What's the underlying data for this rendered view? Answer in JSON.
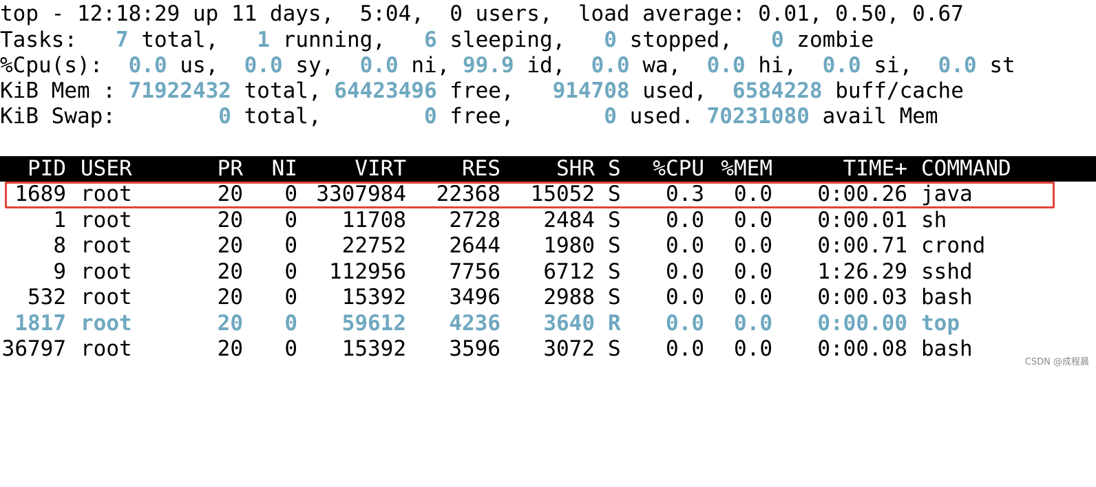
{
  "summary": {
    "line1": "top - 12:18:29 up 11 days,  5:04,  0 users,  load average: 0.01, 0.50, 0.67",
    "tasks": {
      "label": "Tasks:",
      "total": "7",
      "total_label": "total,",
      "running": "1",
      "running_label": "running,",
      "sleeping": "6",
      "sleeping_label": "sleeping,",
      "stopped": "0",
      "stopped_label": "stopped,",
      "zombie": "0",
      "zombie_label": "zombie"
    },
    "cpu": {
      "label": "%Cpu(s):",
      "us": "0.0",
      "us_label": "us,",
      "sy": "0.0",
      "sy_label": "sy,",
      "ni": "0.0",
      "ni_label": "ni,",
      "id": "99.9",
      "id_label": "id,",
      "wa": "0.0",
      "wa_label": "wa,",
      "hi": "0.0",
      "hi_label": "hi,",
      "si": "0.0",
      "si_label": "si,",
      "st": "0.0",
      "st_label": "st"
    },
    "mem": {
      "label": "KiB Mem :",
      "total": "71922432",
      "total_label": "total,",
      "free": "64423496",
      "free_label": "free,",
      "used": "914708",
      "used_label": "used,",
      "buff": "6584228",
      "buff_label": "buff/cache"
    },
    "swap": {
      "label": "KiB Swap:",
      "total": "0",
      "total_label": "total,",
      "free": "0",
      "free_label": "free,",
      "used": "0",
      "used_label": "used.",
      "avail": "70231080",
      "avail_label": "avail Mem"
    }
  },
  "columns": {
    "pid": "PID",
    "user": "USER",
    "pr": "PR",
    "ni": "NI",
    "virt": "VIRT",
    "res": "RES",
    "shr": "SHR",
    "s": "S",
    "cpu": "%CPU",
    "mem": "%MEM",
    "time": "TIME+",
    "command": "COMMAND"
  },
  "processes": [
    {
      "pid": "1689",
      "user": "root",
      "pr": "20",
      "ni": "0",
      "virt": "3307984",
      "res": "22368",
      "shr": "15052",
      "s": "S",
      "cpu": "0.3",
      "mem": "0.0",
      "time": "0:00.26",
      "command": "java"
    },
    {
      "pid": "1",
      "user": "root",
      "pr": "20",
      "ni": "0",
      "virt": "11708",
      "res": "2728",
      "shr": "2484",
      "s": "S",
      "cpu": "0.0",
      "mem": "0.0",
      "time": "0:00.01",
      "command": "sh"
    },
    {
      "pid": "8",
      "user": "root",
      "pr": "20",
      "ni": "0",
      "virt": "22752",
      "res": "2644",
      "shr": "1980",
      "s": "S",
      "cpu": "0.0",
      "mem": "0.0",
      "time": "0:00.71",
      "command": "crond"
    },
    {
      "pid": "9",
      "user": "root",
      "pr": "20",
      "ni": "0",
      "virt": "112956",
      "res": "7756",
      "shr": "6712",
      "s": "S",
      "cpu": "0.0",
      "mem": "0.0",
      "time": "1:26.29",
      "command": "sshd"
    },
    {
      "pid": "532",
      "user": "root",
      "pr": "20",
      "ni": "0",
      "virt": "15392",
      "res": "3496",
      "shr": "2988",
      "s": "S",
      "cpu": "0.0",
      "mem": "0.0",
      "time": "0:00.03",
      "command": "bash"
    },
    {
      "pid": "1817",
      "user": "root",
      "pr": "20",
      "ni": "0",
      "virt": "59612",
      "res": "4236",
      "shr": "3640",
      "s": "R",
      "cpu": "0.0",
      "mem": "0.0",
      "time": "0:00.00",
      "command": "top"
    },
    {
      "pid": "36797",
      "user": "root",
      "pr": "20",
      "ni": "0",
      "virt": "15392",
      "res": "3596",
      "shr": "3072",
      "s": "S",
      "cpu": "0.0",
      "mem": "0.0",
      "time": "0:00.08",
      "command": "bash"
    }
  ],
  "highlighted_pid": "1689",
  "watermark": "CSDN @成程晨",
  "colors": {
    "value_accent": "#6fa8c0",
    "highlight_border": "#e0453a",
    "header_bg": "#000000"
  }
}
